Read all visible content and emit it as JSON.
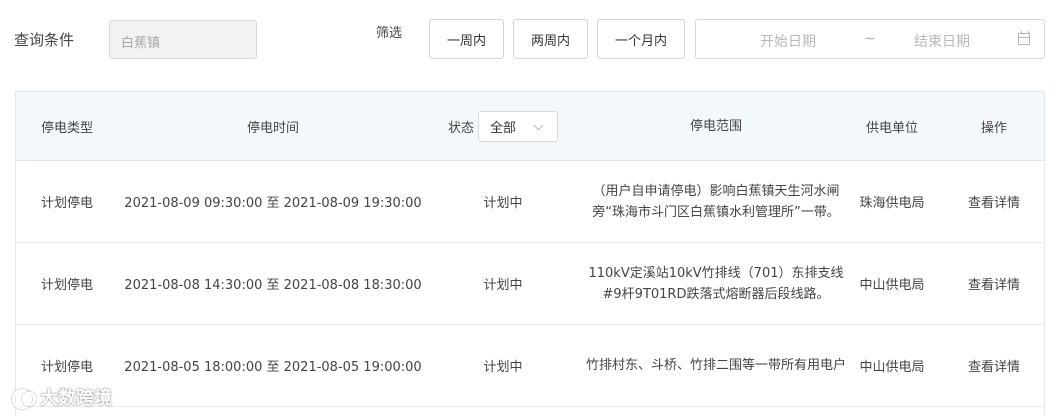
{
  "query": {
    "label": "查询条件",
    "town_placeholder": "白蕉镇"
  },
  "filter": {
    "label": "筛选",
    "buttons": [
      "一周内",
      "两周内",
      "一个月内"
    ],
    "start_placeholder": "开始日期",
    "separator": "~",
    "end_placeholder": "结束日期"
  },
  "table": {
    "headers": {
      "type": "停电类型",
      "time": "停电时间",
      "status": "状态",
      "range": "停电范围",
      "unit": "供电单位",
      "op": "操作"
    },
    "status_select": "全部",
    "rows": [
      {
        "type": "计划停电",
        "time": "2021-08-09 09:30:00 至 2021-08-09 19:30:00",
        "status": "计划中",
        "range": "（用户自申请停电）影响白蕉镇天生河水闸旁“珠海市斗门区白蕉镇水利管理所”一带。",
        "unit": "珠海供电局",
        "op": "查看详情"
      },
      {
        "type": "计划停电",
        "time": "2021-08-08 14:30:00 至 2021-08-08 18:30:00",
        "status": "计划中",
        "range": "110kV定溪站10kV竹排线（701）东排支线#9杆9T01RD跌落式熔断器后段线路。",
        "unit": "中山供电局",
        "op": "查看详情"
      },
      {
        "type": "计划停电",
        "time": "2021-08-05 18:00:00 至 2021-08-05 19:00:00",
        "status": "计划中",
        "range": "竹排村东、斗桥、竹排二围等一带所有用电户",
        "unit": "中山供电局",
        "op": "查看详情"
      }
    ]
  },
  "watermark": {
    "text": "大数跨境"
  }
}
